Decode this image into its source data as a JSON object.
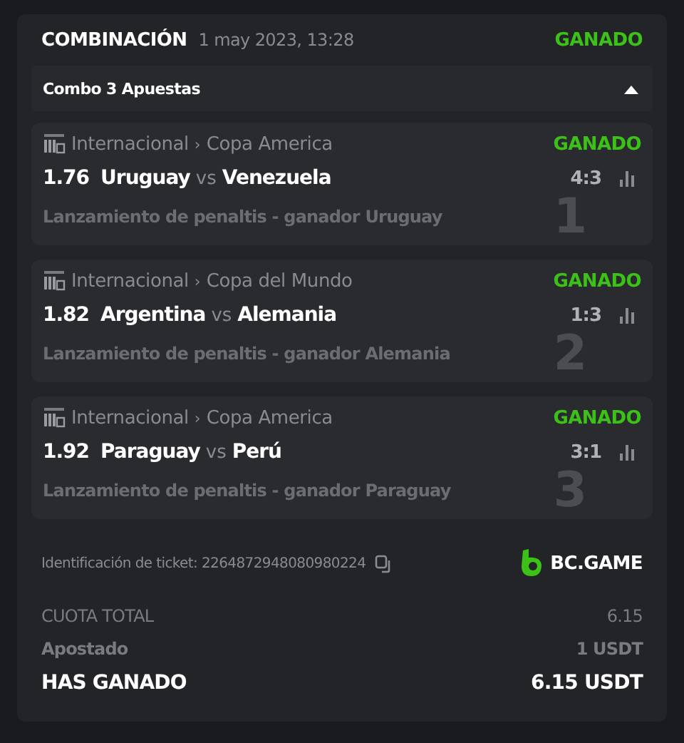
{
  "header": {
    "title": "COMBINACIÓN",
    "date": "1 may 2023, 13:28",
    "status": {
      "label": "GANADO",
      "kind": "won"
    }
  },
  "combo": {
    "label": "Combo 3 Apuestas",
    "expanded": true
  },
  "bets": [
    {
      "league": "Internacional",
      "separator": "›",
      "competition": "Copa America",
      "status": {
        "label": "GANADO",
        "kind": "won"
      },
      "odds": "1.76",
      "home": "Uruguay",
      "vs": "vs",
      "away": "Venezuela",
      "score": "4:3",
      "market": "Lanzamiento de penaltis - ganador Uruguay",
      "index": "1"
    },
    {
      "league": "Internacional",
      "separator": "›",
      "competition": "Copa del Mundo",
      "status": {
        "label": "GANADO",
        "kind": "won"
      },
      "odds": "1.82",
      "home": "Argentina",
      "vs": "vs",
      "away": "Alemania",
      "score": "1:3",
      "market": "Lanzamiento de penaltis - ganador Alemania",
      "index": "2"
    },
    {
      "league": "Internacional",
      "separator": "›",
      "competition": "Copa America",
      "status": {
        "label": "GANADO",
        "kind": "won"
      },
      "odds": "1.92",
      "home": "Paraguay",
      "vs": "vs",
      "away": "Perú",
      "score": "3:1",
      "market": "Lanzamiento de penaltis - ganador Paraguay",
      "index": "3"
    }
  ],
  "ticket": {
    "label": "Identificación de ticket: 2264872948080980224"
  },
  "brand": "BC.GAME",
  "totals": [
    {
      "label": "CUOTA TOTAL",
      "value": "6.15",
      "kind": "muted"
    },
    {
      "label": "Apostado",
      "value": "1 USDT",
      "kind": "plain"
    },
    {
      "label": "HAS GANADO",
      "value": "6.15 USDT",
      "kind": "strong"
    }
  ]
}
